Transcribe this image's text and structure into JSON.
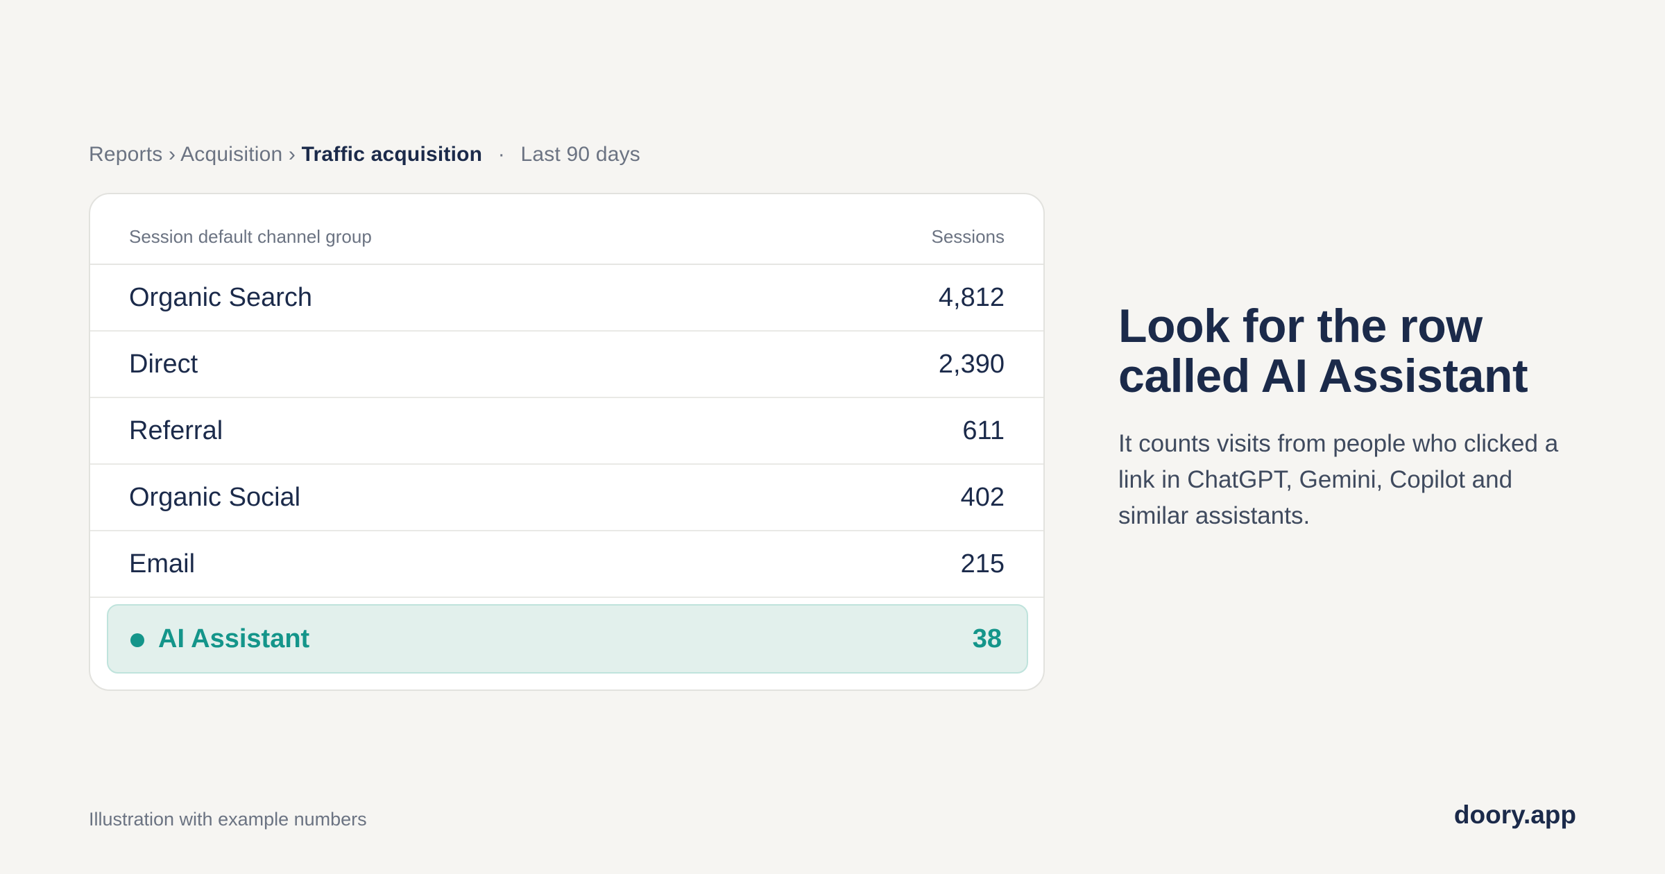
{
  "breadcrumb": {
    "items": [
      "Reports",
      "Acquisition"
    ],
    "separator": "›",
    "current": "Traffic acquisition",
    "dot": "·",
    "date_range": "Last 90 days"
  },
  "table": {
    "columns": {
      "label": "Session default channel group",
      "value": "Sessions"
    },
    "rows": [
      {
        "label": "Organic Search",
        "value": "4,812"
      },
      {
        "label": "Direct",
        "value": "2,390"
      },
      {
        "label": "Referral",
        "value": "611"
      },
      {
        "label": "Organic Social",
        "value": "402"
      },
      {
        "label": "Email",
        "value": "215"
      }
    ],
    "highlight": {
      "label": "AI Assistant",
      "value": "38",
      "icon": "dot-icon",
      "color": "#14958a"
    }
  },
  "callout": {
    "headline": "Look for the row called AI Assistant",
    "body": "It counts visits from people who clicked a link in ChatGPT, Gemini, Copilot and similar assistants."
  },
  "footer": {
    "note": "Illustration with example numbers",
    "brand": "doory.app"
  }
}
